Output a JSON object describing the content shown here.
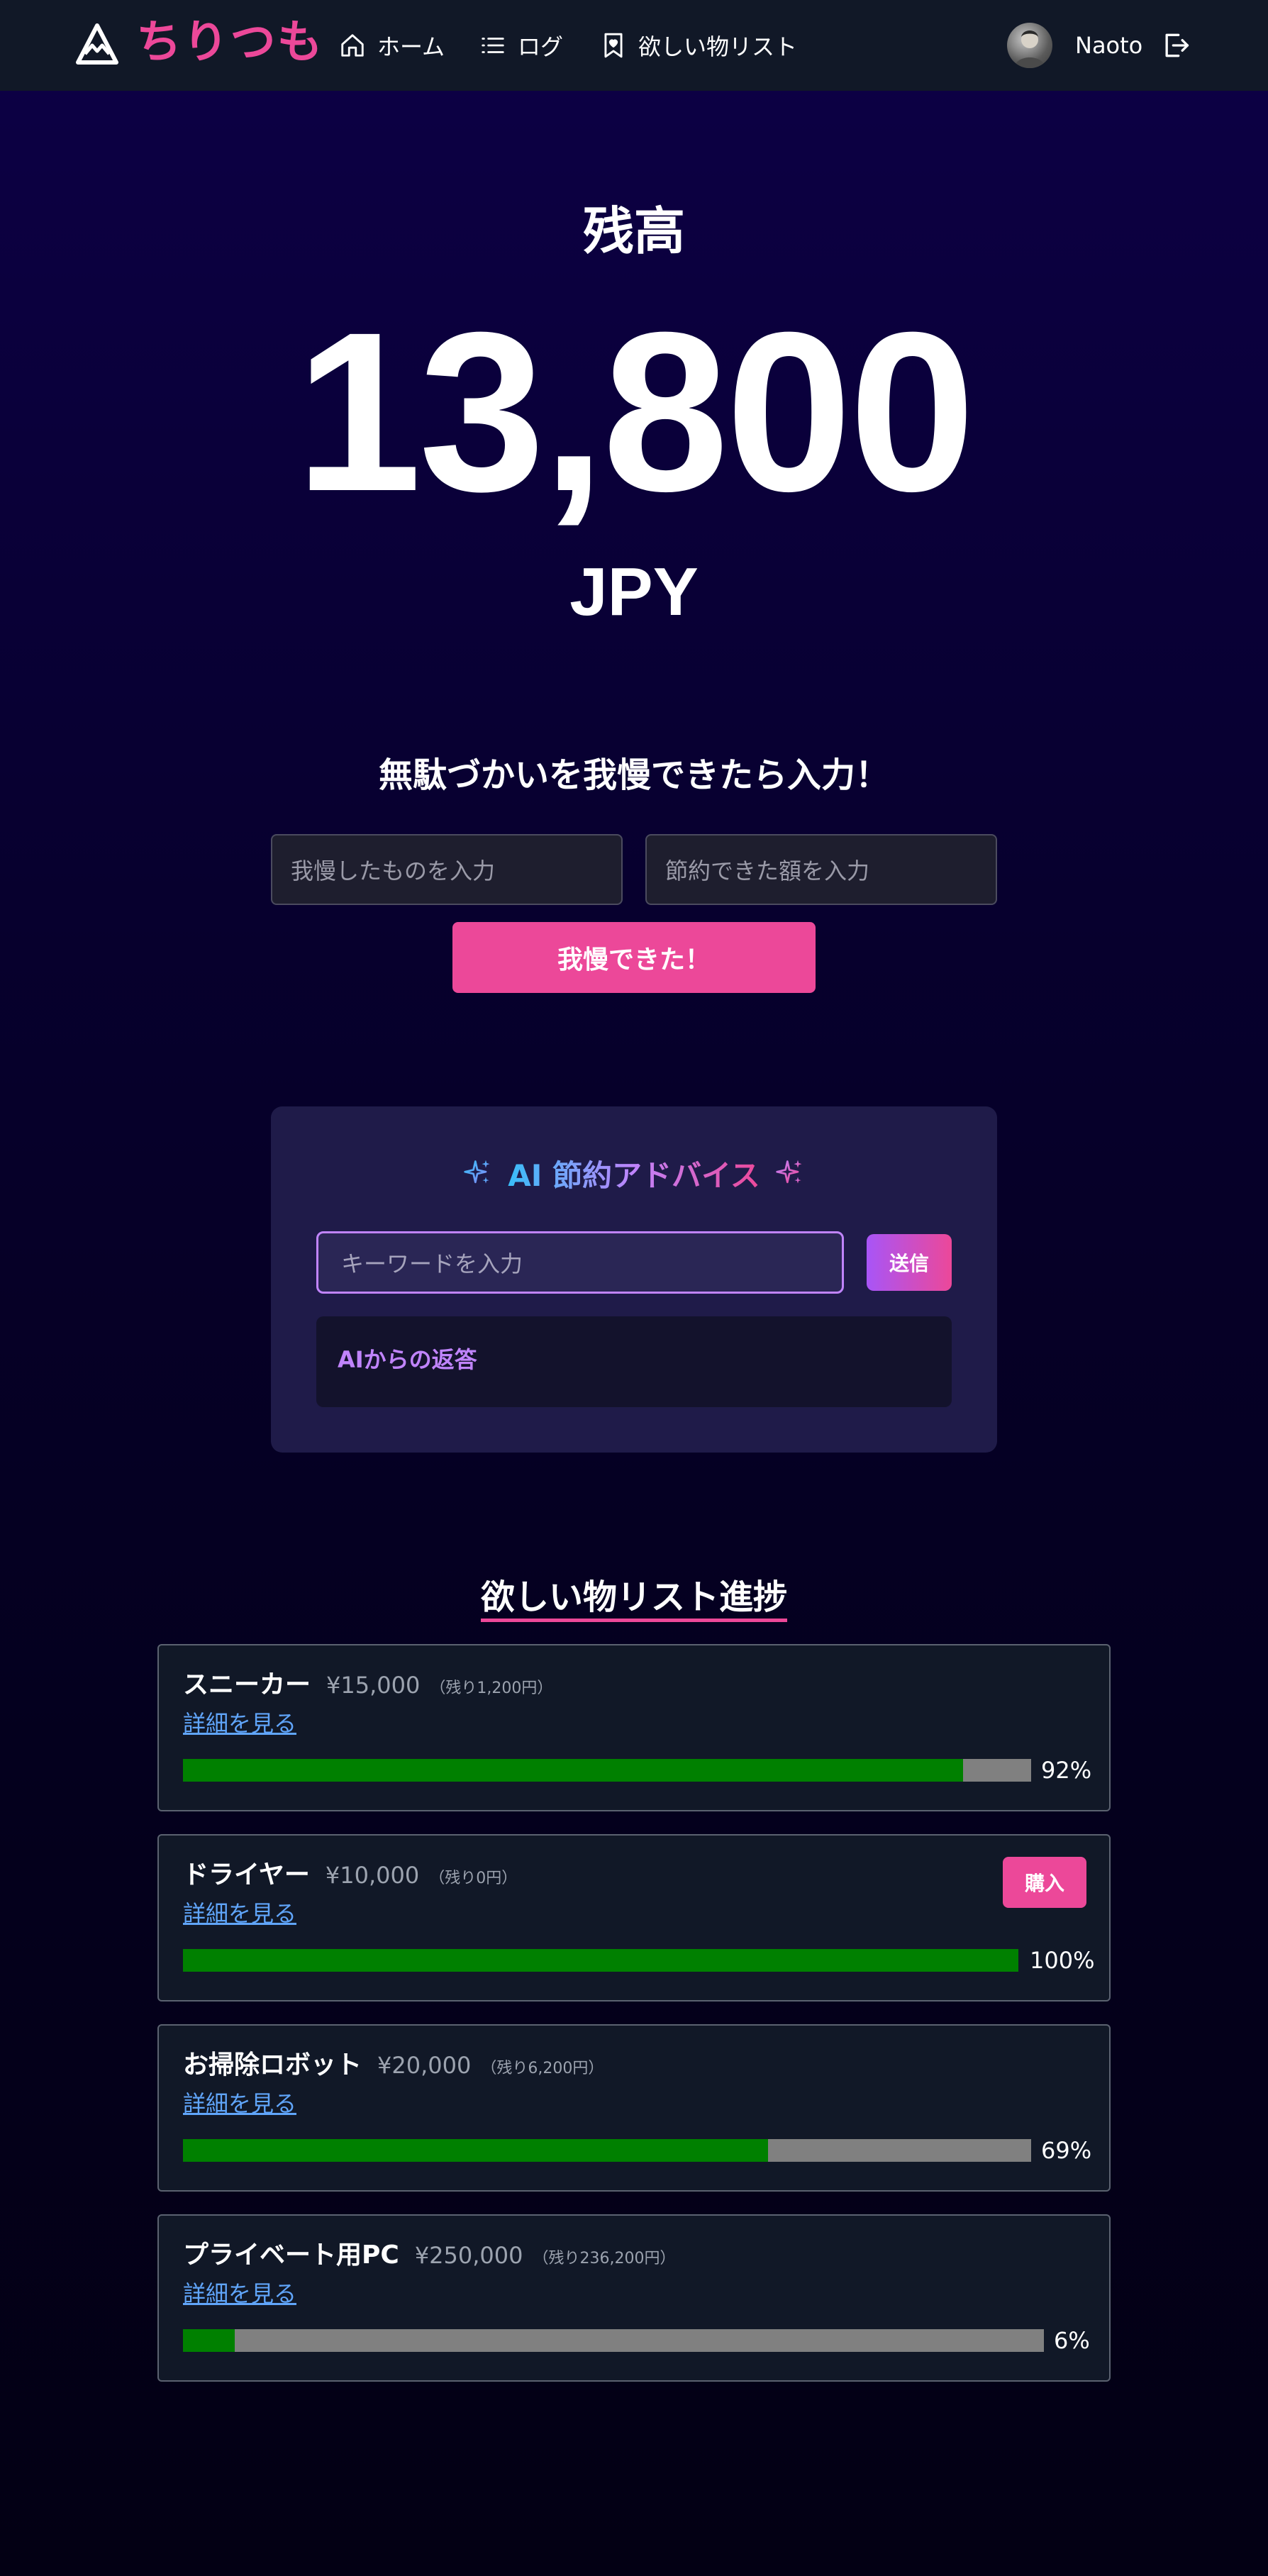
{
  "nav": {
    "brand": "ちりつも",
    "home": "ホーム",
    "log": "ログ",
    "wishlist": "欲しい物リスト",
    "username": "Naoto"
  },
  "balance": {
    "label": "残高",
    "value": "13,800",
    "currency": "JPY"
  },
  "save_form": {
    "title": "無駄づかいを我慢できたら入力！",
    "item_placeholder": "我慢したものを入力",
    "amount_placeholder": "節約できた額を入力",
    "submit": "我慢できた！"
  },
  "ai": {
    "title": "AI 節約アドバイス",
    "input_placeholder": "キーワードを入力",
    "send": "送信",
    "response_label": "AIからの返答"
  },
  "wishlist": {
    "title": "欲しい物リスト進捗",
    "detail_link": "詳細を見る",
    "buy_label": "購入",
    "items": [
      {
        "name": "スニーカー",
        "price": "¥15,000",
        "remaining": "（残り1,200円）",
        "percent": 92,
        "percent_label": "92%",
        "can_buy": false
      },
      {
        "name": "ドライヤー",
        "price": "¥10,000",
        "remaining": "（残り0円）",
        "percent": 100,
        "percent_label": "100%",
        "can_buy": true
      },
      {
        "name": "お掃除ロボット",
        "price": "¥20,000",
        "remaining": "（残り6,200円）",
        "percent": 69,
        "percent_label": "69%",
        "can_buy": false
      },
      {
        "name": "プライベート用PC",
        "price": "¥250,000",
        "remaining": "（残り236,200円）",
        "percent": 6,
        "percent_label": "6%",
        "can_buy": false
      }
    ]
  },
  "colors": {
    "accent": "#ec4899",
    "progress_fill": "#008000",
    "progress_track": "#808080",
    "link": "#60a5fa"
  }
}
